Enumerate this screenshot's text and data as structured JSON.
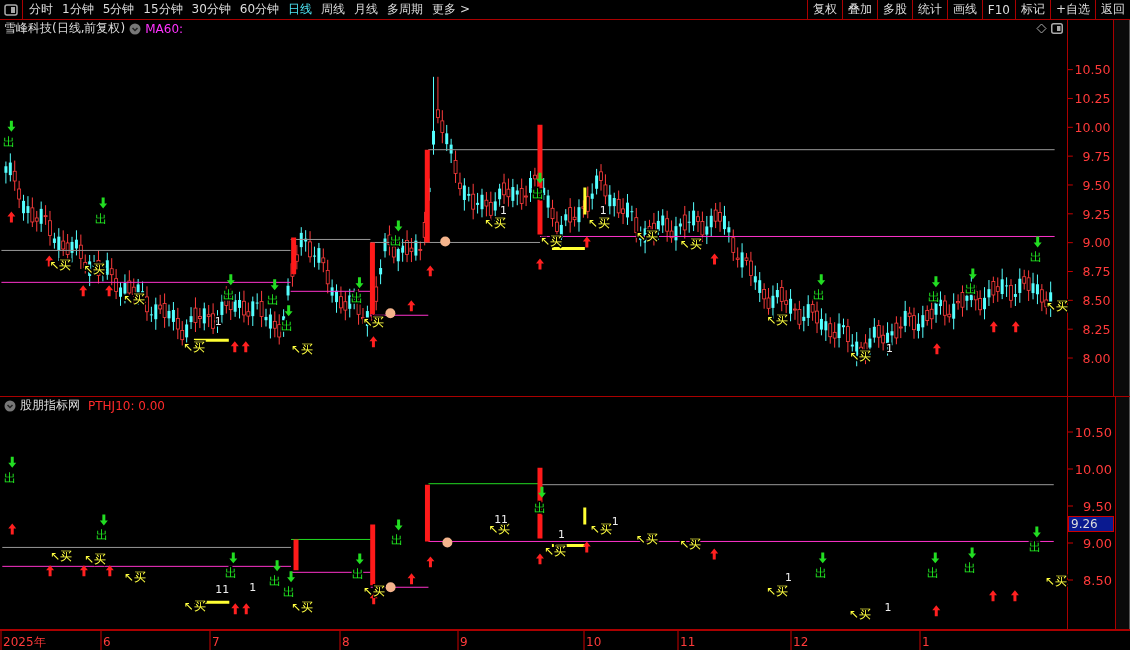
{
  "toolbar": {
    "periods": [
      {
        "label": "分时",
        "selected": false
      },
      {
        "label": "1分钟",
        "selected": false
      },
      {
        "label": "5分钟",
        "selected": false
      },
      {
        "label": "15分钟",
        "selected": false
      },
      {
        "label": "30分钟",
        "selected": false
      },
      {
        "label": "60分钟",
        "selected": false
      },
      {
        "label": "日线",
        "selected": true
      },
      {
        "label": "周线",
        "selected": false
      },
      {
        "label": "月线",
        "selected": false
      },
      {
        "label": "多周期",
        "selected": false
      },
      {
        "label": "更多 >",
        "selected": false
      }
    ],
    "buttons": [
      "复权",
      "叠加",
      "多股",
      "统计",
      "画线",
      "F10",
      "标记",
      "+自选",
      "返回"
    ]
  },
  "upper": {
    "title": "雪峰科技(日线,前复权)",
    "indicator": "MA60:",
    "yticks": [
      "10.50",
      "10.25",
      "10.00",
      "9.75",
      "9.50",
      "9.25",
      "9.00",
      "8.75",
      "8.50",
      "8.25",
      "8.00"
    ],
    "signals": [
      {
        "kind": "sell",
        "label": "出"
      },
      {
        "kind": "buy",
        "label": "↖买"
      },
      {
        "kind": "buy",
        "label": "↖买"
      },
      {
        "kind": "sell",
        "label": "出"
      },
      {
        "kind": "buy",
        "label": "↖买"
      },
      {
        "kind": "buy",
        "label": "↖买"
      },
      {
        "kind": "sell",
        "label": "出"
      },
      {
        "kind": "sell",
        "label": "出"
      },
      {
        "kind": "sell",
        "label": "出"
      },
      {
        "kind": "buy",
        "label": "↖买"
      },
      {
        "kind": "sell",
        "label": "出"
      },
      {
        "kind": "buy",
        "label": "↖买"
      },
      {
        "kind": "sell",
        "label": "出"
      },
      {
        "kind": "buy",
        "label": "↖买"
      },
      {
        "kind": "sell",
        "label": "出"
      },
      {
        "kind": "buy",
        "label": "↖买"
      },
      {
        "kind": "buy",
        "label": "↖买"
      },
      {
        "kind": "buy",
        "label": "↖买"
      },
      {
        "kind": "buy",
        "label": "↖买"
      },
      {
        "kind": "buy",
        "label": "↖买"
      },
      {
        "kind": "sell",
        "label": "出"
      },
      {
        "kind": "buy",
        "label": "↖买"
      },
      {
        "kind": "sell",
        "label": "出"
      },
      {
        "kind": "sell",
        "label": "出"
      },
      {
        "kind": "sell",
        "label": "出"
      },
      {
        "kind": "buy",
        "label": "↖买"
      }
    ],
    "marks": [
      "1",
      "1",
      "1",
      "1"
    ]
  },
  "lower": {
    "title": "股朋指标网",
    "indicator": "PTHJ10: 0.00",
    "yticks": [
      "10.50",
      "10.00",
      "9.50",
      "9.00",
      "8.50"
    ],
    "current_price": "9.26",
    "signals": [
      {
        "kind": "sell",
        "label": "出"
      },
      {
        "kind": "buy",
        "label": "↖买"
      },
      {
        "kind": "buy",
        "label": "↖买"
      },
      {
        "kind": "sell",
        "label": "出"
      },
      {
        "kind": "buy",
        "label": "↖买"
      },
      {
        "kind": "buy",
        "label": "↖买"
      },
      {
        "kind": "sell",
        "label": "出"
      },
      {
        "kind": "sell",
        "label": "出"
      },
      {
        "kind": "sell",
        "label": "出"
      },
      {
        "kind": "buy",
        "label": "↖买"
      },
      {
        "kind": "sell",
        "label": "出"
      },
      {
        "kind": "buy",
        "label": "↖买"
      },
      {
        "kind": "sell",
        "label": "出"
      },
      {
        "kind": "buy",
        "label": "↖买"
      },
      {
        "kind": "sell",
        "label": "出"
      },
      {
        "kind": "buy",
        "label": "↖买"
      },
      {
        "kind": "buy",
        "label": "↖买"
      },
      {
        "kind": "buy",
        "label": "↖买"
      },
      {
        "kind": "buy",
        "label": "↖买"
      },
      {
        "kind": "buy",
        "label": "↖买"
      },
      {
        "kind": "sell",
        "label": "出"
      },
      {
        "kind": "buy",
        "label": "↖买"
      },
      {
        "kind": "sell",
        "label": "出"
      },
      {
        "kind": "sell",
        "label": "出"
      },
      {
        "kind": "sell",
        "label": "出"
      },
      {
        "kind": "buy",
        "label": "↖买"
      }
    ],
    "marks": [
      "11",
      "1",
      "11",
      "1",
      "1",
      "1",
      "1"
    ]
  },
  "date_axis": [
    "2025年",
    "6",
    "7",
    "8",
    "9",
    "10",
    "11",
    "12",
    "1"
  ]
}
